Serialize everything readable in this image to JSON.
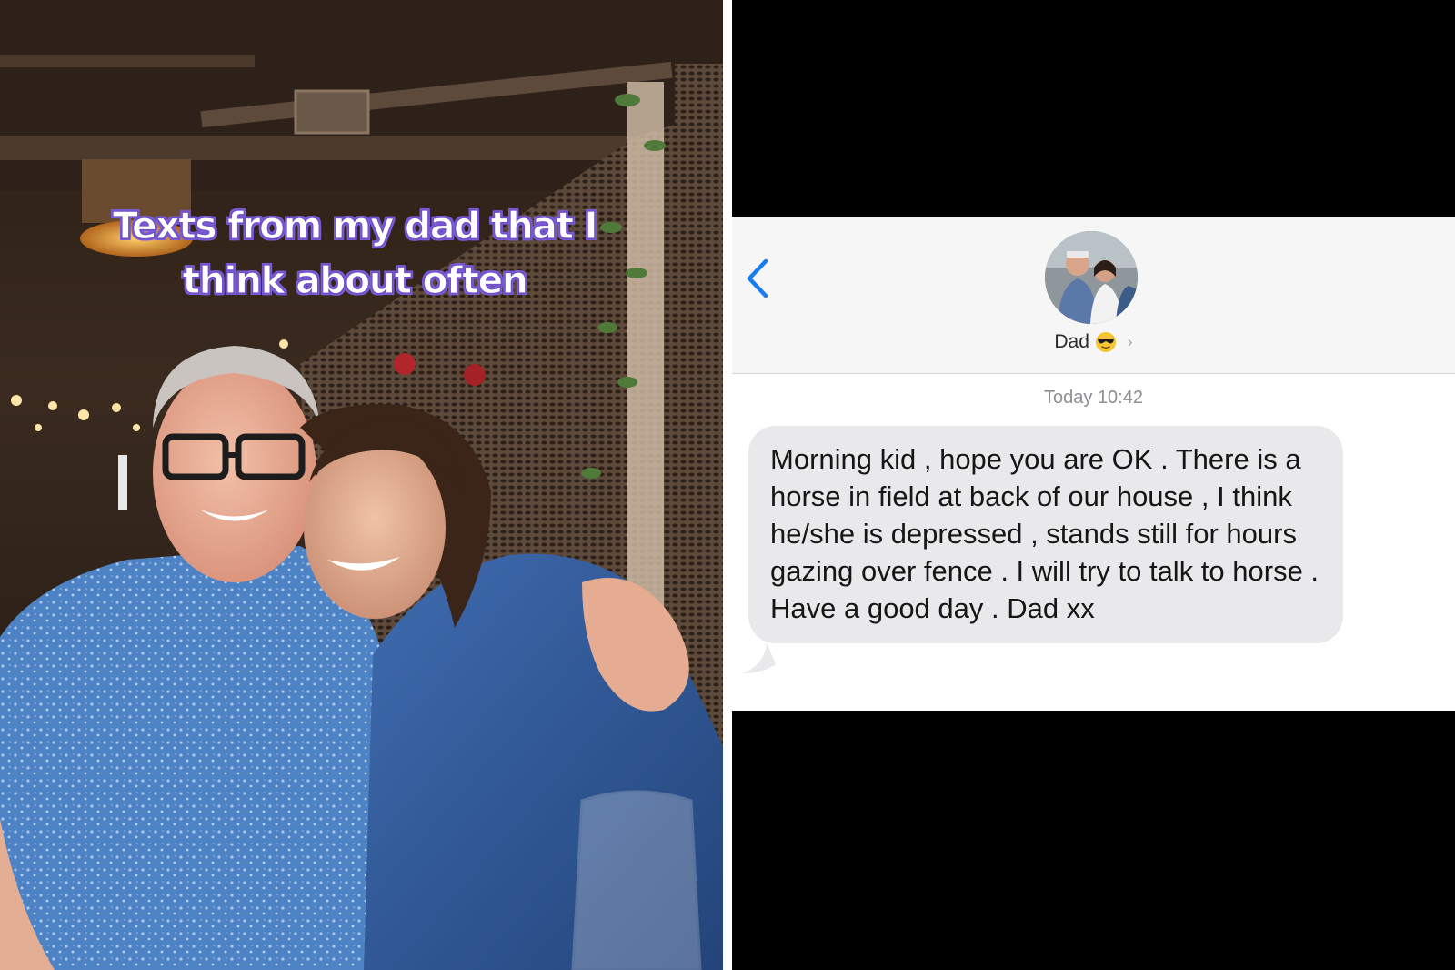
{
  "photo": {
    "caption_line1": "Texts from my dad that I",
    "caption_line2": "think about often",
    "caption_stroke_color": "#7a5ad6"
  },
  "conversation": {
    "back_icon": "chevron-left-icon",
    "contact_name": "Dad",
    "contact_emoji": "😎",
    "contact_chevron": "›",
    "timestamp_day": "Today",
    "timestamp_time": "10:42",
    "message_text": "Morning kid , hope you are OK . There is a horse in field at back of our house , I think he/she is depressed , stands still for hours gazing over fence . I will try to talk to horse . Have a good day . Dad xx",
    "accent_color": "#1a7cf5",
    "bubble_color": "#e9e9eb"
  }
}
